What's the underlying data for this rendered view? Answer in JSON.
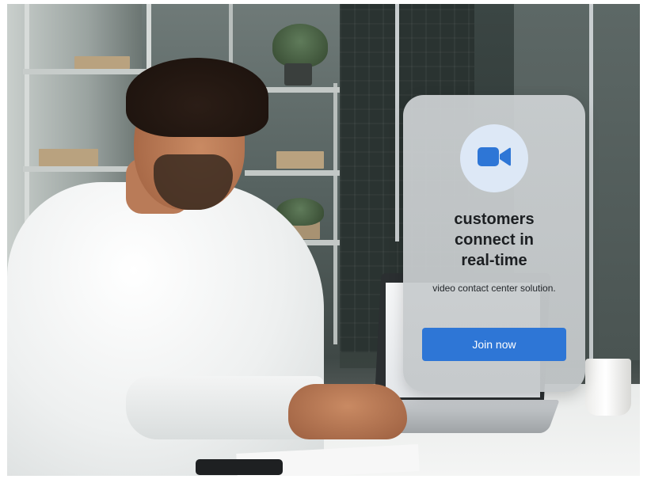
{
  "card": {
    "icon": "video-camera-icon",
    "title": "customers\nconnect in\nreal-time",
    "subtitle": "video contact center solution.",
    "button_label": "Join now"
  },
  "colors": {
    "accent": "#2e76d6",
    "icon_bg": "#dde8f6",
    "card_bg": "#c9cdcf",
    "title_text": "#1c1f22"
  }
}
